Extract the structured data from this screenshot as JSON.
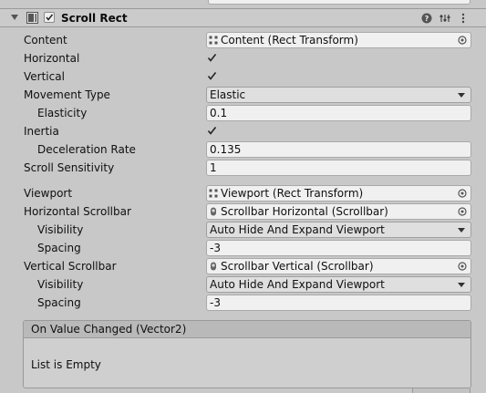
{
  "component": {
    "title": "Scroll Rect",
    "enabled": true,
    "header_icons": [
      "help-icon",
      "preset-icon",
      "kebab-menu-icon"
    ]
  },
  "fields": {
    "content": {
      "label": "Content",
      "value": "Content (Rect Transform)",
      "icon": "rect-transform-icon"
    },
    "horizontal": {
      "label": "Horizontal",
      "checked": true
    },
    "vertical": {
      "label": "Vertical",
      "checked": true
    },
    "movement_type": {
      "label": "Movement Type",
      "value": "Elastic"
    },
    "elasticity": {
      "label": "Elasticity",
      "value": "0.1"
    },
    "inertia": {
      "label": "Inertia",
      "checked": true
    },
    "deceleration_rate": {
      "label": "Deceleration Rate",
      "value": "0.135"
    },
    "scroll_sensitivity": {
      "label": "Scroll Sensitivity",
      "value": "1"
    },
    "viewport": {
      "label": "Viewport",
      "value": "Viewport (Rect Transform)",
      "icon": "rect-transform-icon"
    },
    "horizontal_scrollbar": {
      "label": "Horizontal Scrollbar",
      "value": "Scrollbar Horizontal (Scrollbar)",
      "icon": "scrollbar-icon"
    },
    "h_visibility": {
      "label": "Visibility",
      "value": "Auto Hide And Expand Viewport"
    },
    "h_spacing": {
      "label": "Spacing",
      "value": "-3"
    },
    "vertical_scrollbar": {
      "label": "Vertical Scrollbar",
      "value": "Scrollbar Vertical (Scrollbar)",
      "icon": "scrollbar-icon"
    },
    "v_visibility": {
      "label": "Visibility",
      "value": "Auto Hide And Expand Viewport"
    },
    "v_spacing": {
      "label": "Spacing",
      "value": "-3"
    }
  },
  "event": {
    "title": "On Value Changed (Vector2)",
    "empty_text": "List is Empty"
  },
  "colors": {
    "background": "#c8c8c8",
    "field_bg": "#f0f0f0",
    "dropdown_bg": "#dfdfdf",
    "border": "#a9a9a9"
  }
}
